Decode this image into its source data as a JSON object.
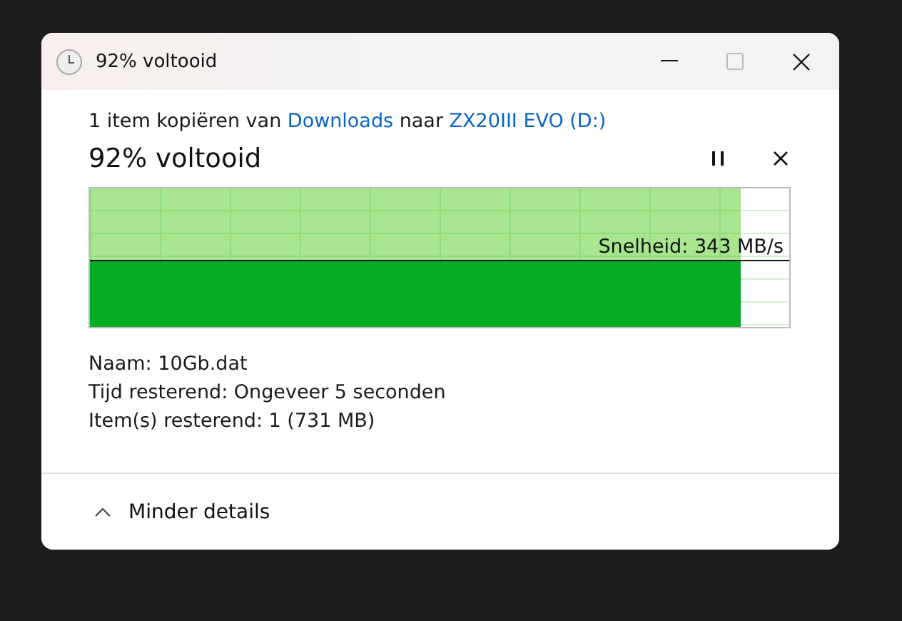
{
  "window": {
    "title": "92% voltooid"
  },
  "summary": {
    "parts": [
      {
        "kind": "plain",
        "text": "1 item kopiëren van "
      },
      {
        "kind": "link",
        "text": "Downloads"
      },
      {
        "kind": "plain",
        "text": " naar "
      },
      {
        "kind": "link",
        "text": "ZX20III EVO (D:)"
      }
    ]
  },
  "progress": {
    "heading": "92% voltooid",
    "level": 0.93,
    "speed_label": "Snelheid: 343 MB/s"
  },
  "details": [
    "Naam: 10Gb.dat",
    "Tijd resterend: Ongeveer 5 seconden",
    "Item(s) resterend: 1 (731 MB)"
  ],
  "footer": {
    "toggle": "Minder details",
    "expanded": true
  }
}
